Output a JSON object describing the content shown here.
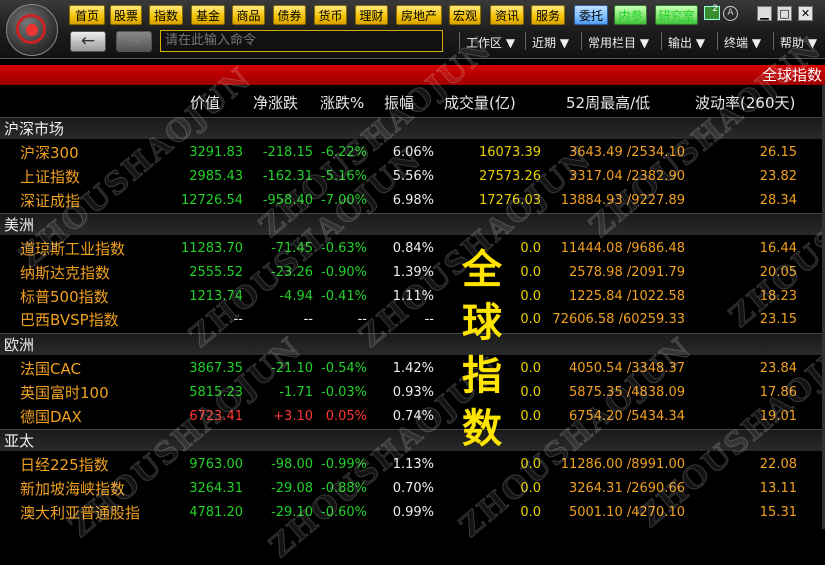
{
  "menu": [
    "首页",
    "股票",
    "指数",
    "基金",
    "商品",
    "债券",
    "货币",
    "理财",
    "房地产",
    "宏观",
    "资讯",
    "服务",
    "委托",
    "内参",
    "研究室"
  ],
  "badge": "2",
  "window_buttons": [
    "▁",
    "□",
    "✕"
  ],
  "command_placeholder": "请在此输入命令",
  "dropdowns": [
    "工作区 ▼",
    "近期 ▼",
    "常用栏目 ▼",
    "输出 ▼",
    "终端 ▼",
    "帮助 ▼"
  ],
  "title": "全球指数",
  "columns": [
    "价值",
    "净涨跌",
    "涨跌%",
    "振幅",
    "成交量(亿)",
    "52周最高/低",
    "波动率(260天)"
  ],
  "watermark": "ZHOUSHAOJUN",
  "caption": [
    "全",
    "球",
    "指",
    "数"
  ],
  "sections": [
    {
      "name": "沪深市场",
      "rows": [
        {
          "name": "沪深300",
          "value": "3291.83",
          "chg": "-218.15",
          "pct": "-6.22%",
          "amp": "6.06%",
          "vol": "16073.39",
          "hl": "3643.49 /2534.10",
          "volat": "26.15",
          "dir": "down"
        },
        {
          "name": "上证指数",
          "value": "2985.43",
          "chg": "-162.31",
          "pct": "-5.16%",
          "amp": "5.56%",
          "vol": "27573.26",
          "hl": "3317.04 /2382.90",
          "volat": "23.82",
          "dir": "down"
        },
        {
          "name": "深证成指",
          "value": "12726.54",
          "chg": "-958.40",
          "pct": "-7.00%",
          "amp": "6.98%",
          "vol": "17276.03",
          "hl": "13884.93 /9227.89",
          "volat": "28.34",
          "dir": "down"
        }
      ]
    },
    {
      "name": "美洲",
      "rows": [
        {
          "name": "道琼斯工业指数",
          "value": "11283.70",
          "chg": "-71.45",
          "pct": "-0.63%",
          "amp": "0.84%",
          "vol": "0.0",
          "hl": "11444.08 /9686.48",
          "volat": "16.44",
          "dir": "down"
        },
        {
          "name": "纳斯达克指数",
          "value": "2555.52",
          "chg": "-23.26",
          "pct": "-0.90%",
          "amp": "1.39%",
          "vol": "0.0",
          "hl": "2578.98 /2091.79",
          "volat": "20.05",
          "dir": "down"
        },
        {
          "name": "标普500指数",
          "value": "1213.74",
          "chg": "-4.94",
          "pct": "-0.41%",
          "amp": "1.11%",
          "vol": "0.0",
          "hl": "1225.84 /1022.58",
          "volat": "18.23",
          "dir": "down"
        },
        {
          "name": "巴西BVSP指数",
          "value": "--",
          "chg": "--",
          "pct": "--",
          "amp": "--",
          "vol": "0.0",
          "hl": "72606.58 /60259.33",
          "volat": "23.15",
          "dir": "none"
        }
      ]
    },
    {
      "name": "欧洲",
      "rows": [
        {
          "name": "法国CAC",
          "value": "3867.35",
          "chg": "-21.10",
          "pct": "-0.54%",
          "amp": "1.42%",
          "vol": "0.0",
          "hl": "4050.54 /3348.37",
          "volat": "23.84",
          "dir": "down"
        },
        {
          "name": "英国富时100",
          "value": "5815.23",
          "chg": "-1.71",
          "pct": "-0.03%",
          "amp": "0.93%",
          "vol": "0.0",
          "hl": "5875.35 /4838.09",
          "volat": "17.86",
          "dir": "down"
        },
        {
          "name": "德国DAX",
          "value": "6723.41",
          "chg": "+3.10",
          "pct": "0.05%",
          "amp": "0.74%",
          "vol": "0.0",
          "hl": "6754.20 /5434.34",
          "volat": "19.01",
          "dir": "up"
        }
      ]
    },
    {
      "name": "亚太",
      "rows": [
        {
          "name": "日经225指数",
          "value": "9763.00",
          "chg": "-98.00",
          "pct": "-0.99%",
          "amp": "1.13%",
          "vol": "0.0",
          "hl": "11286.00 /8991.00",
          "volat": "22.08",
          "dir": "down"
        },
        {
          "name": "新加坡海峡指数",
          "value": "3264.31",
          "chg": "-29.08",
          "pct": "-0.88%",
          "amp": "0.70%",
          "vol": "0.0",
          "hl": "3264.31 /2690.66",
          "volat": "13.11",
          "dir": "down"
        },
        {
          "name": "澳大利亚普通股指",
          "value": "4781.20",
          "chg": "-29.10",
          "pct": "-0.60%",
          "amp": "0.99%",
          "vol": "0.0",
          "hl": "5001.10 /4270.10",
          "volat": "15.31",
          "dir": "down"
        }
      ]
    }
  ],
  "colors": {
    "up": "#ff3535",
    "down": "#22d02a",
    "name": "#f0a020",
    "vol": "#e8d000",
    "title_bar": "#c00000"
  }
}
